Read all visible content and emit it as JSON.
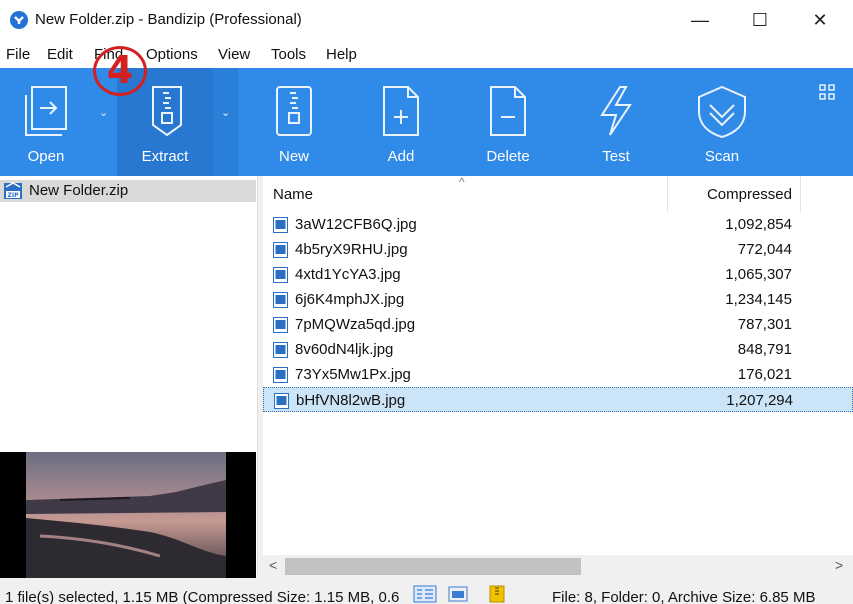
{
  "window": {
    "title": "New Folder.zip - Bandizip (Professional)",
    "minimize_glyph": "—",
    "maximize_glyph": "☐",
    "close_glyph": "✕"
  },
  "menu": [
    "File",
    "Edit",
    "Find",
    "Options",
    "View",
    "Tools",
    "Help"
  ],
  "toolbar": {
    "accent_color": "#2f8ae8",
    "buttons": [
      {
        "label": "Open",
        "icon": "open-archive-icon"
      },
      {
        "label": "Extract",
        "icon": "extract-icon"
      },
      {
        "label": "New",
        "icon": "new-archive-icon"
      },
      {
        "label": "Add",
        "icon": "add-file-icon"
      },
      {
        "label": "Delete",
        "icon": "delete-file-icon"
      },
      {
        "label": "Test",
        "icon": "test-lightning-icon"
      },
      {
        "label": "Scan",
        "icon": "scan-shield-icon"
      }
    ],
    "dropdown_glyph": "⌄"
  },
  "annotation": {
    "text": "4",
    "color": "#d42020"
  },
  "tree": {
    "item_label": "New Folder.zip"
  },
  "file_list": {
    "columns": {
      "name": "Name",
      "compressed": "Compressed",
      "sort_glyph": "^"
    },
    "rows": [
      {
        "name": "3aW12CFB6Q.jpg",
        "compressed": "1,092,854",
        "selected": false
      },
      {
        "name": "4b5ryX9RHU.jpg",
        "compressed": "772,044",
        "selected": false
      },
      {
        "name": "4xtd1YcYA3.jpg",
        "compressed": "1,065,307",
        "selected": false
      },
      {
        "name": "6j6K4mphJX.jpg",
        "compressed": "1,234,145",
        "selected": false
      },
      {
        "name": "7pMQWza5qd.jpg",
        "compressed": "787,301",
        "selected": false
      },
      {
        "name": "8v60dN4ljk.jpg",
        "compressed": "848,791",
        "selected": false
      },
      {
        "name": "73Yx5Mw1Px.jpg",
        "compressed": "176,021",
        "selected": false
      },
      {
        "name": "bHfVN8l2wB.jpg",
        "compressed": "1,207,294",
        "selected": true
      }
    ]
  },
  "scrollbar": {
    "left_glyph": "<",
    "right_glyph": ">"
  },
  "status": {
    "left": "1 file(s) selected, 1.15 MB (Compressed Size: 1.15 MB, 0.6",
    "right": "File: 8, Folder: 0, Archive Size: 6.85 MB"
  }
}
